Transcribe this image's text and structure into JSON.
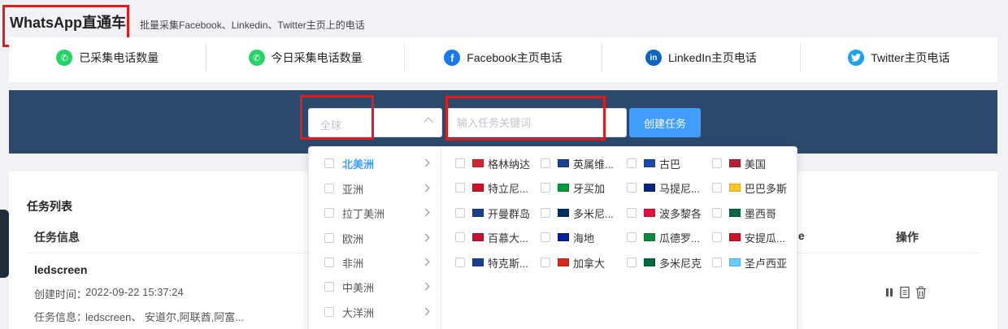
{
  "app": {
    "title": "WhatsApp直通车",
    "subtitle": "批量采集Facebook、Linkedin、Twitter主页上的电话"
  },
  "stats": [
    {
      "label": "已采集电话数量",
      "icon": "whatsapp-icon",
      "color": "#25d366",
      "glyph": "✆"
    },
    {
      "label": "今日采集电话数量",
      "icon": "whatsapp-icon",
      "color": "#25d366",
      "glyph": "✆"
    },
    {
      "label": "Facebook主页电话",
      "icon": "facebook-icon",
      "color": "#1877f2",
      "glyph": "f"
    },
    {
      "label": "LinkedIn主页电话",
      "icon": "linkedin-icon",
      "color": "#0a66c2",
      "glyph": "in"
    },
    {
      "label": "Twitter主页电话",
      "icon": "twitter-icon",
      "color": "#1da1f2",
      "glyph": "t"
    }
  ],
  "search": {
    "region_placeholder": "全球",
    "keyword_placeholder": "输入任务关键词",
    "create_button": "创建任务"
  },
  "region_dropdown": {
    "continents": [
      {
        "label": "北美洲",
        "active": true
      },
      {
        "label": "亚洲",
        "active": false
      },
      {
        "label": "拉丁美洲",
        "active": false
      },
      {
        "label": "欧洲",
        "active": false
      },
      {
        "label": "非洲",
        "active": false
      },
      {
        "label": "中美洲",
        "active": false
      },
      {
        "label": "大洋洲",
        "active": false
      }
    ],
    "countries": [
      [
        "格林纳达",
        "英属维...",
        "古巴",
        "美国"
      ],
      [
        "特立尼...",
        "牙买加",
        "马提尼...",
        "巴巴多斯"
      ],
      [
        "开曼群岛",
        "多米尼...",
        "波多黎各",
        "墨西哥"
      ],
      [
        "百慕大...",
        "海地",
        "瓜德罗...",
        "安提瓜..."
      ],
      [
        "特克斯...",
        "加拿大",
        "多米尼克",
        "圣卢西亚"
      ]
    ],
    "flag_colors": [
      [
        "#d2262d",
        "#1a3f8f",
        "#1a4aa8",
        "#b22234"
      ],
      [
        "#ce1126",
        "#009b3a",
        "#00267f",
        "#ffc726"
      ],
      [
        "#1a3f8f",
        "#002d62",
        "#ed0a3f",
        "#006847"
      ],
      [
        "#c8102e",
        "#00209f",
        "#0b8a3c",
        "#ce1126"
      ],
      [
        "#1a3f8f",
        "#d52b1e",
        "#006b3f",
        "#66ccff"
      ]
    ]
  },
  "tasks": {
    "title": "任务列表",
    "columns": {
      "info": "任务信息",
      "partial": "le",
      "ops": "操作"
    },
    "rows": [
      {
        "name": "ledscreen",
        "created_label": "创建时间：",
        "created_value": "2022-09-22 15:37:24",
        "info_label": "任务信息：",
        "info_value": "ledscreen、 安道尔,阿联酋,阿富..."
      }
    ]
  }
}
